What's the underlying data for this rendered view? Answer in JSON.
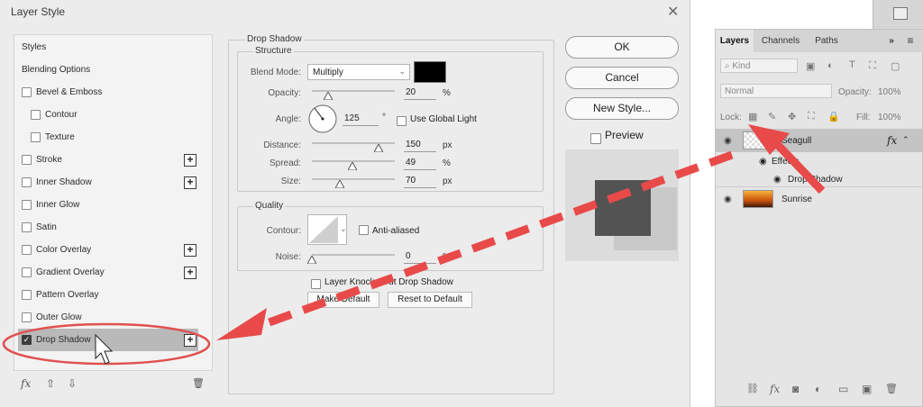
{
  "dialog": {
    "title": "Layer Style",
    "close_glyph": "✕",
    "styles": [
      {
        "label": "Styles",
        "has_checkbox": false,
        "checked": false,
        "has_plus": false
      },
      {
        "label": "Blending Options",
        "has_checkbox": false,
        "checked": false,
        "has_plus": false
      },
      {
        "label": "Bevel & Emboss",
        "has_checkbox": true,
        "checked": false,
        "has_plus": false
      },
      {
        "label": "Contour",
        "has_checkbox": true,
        "checked": false,
        "has_plus": false
      },
      {
        "label": "Texture",
        "has_checkbox": true,
        "checked": false,
        "has_plus": false
      },
      {
        "label": "Stroke",
        "has_checkbox": true,
        "checked": false,
        "has_plus": true
      },
      {
        "label": "Inner Shadow",
        "has_checkbox": true,
        "checked": false,
        "has_plus": true
      },
      {
        "label": "Inner Glow",
        "has_checkbox": true,
        "checked": false,
        "has_plus": false
      },
      {
        "label": "Satin",
        "has_checkbox": true,
        "checked": false,
        "has_plus": false
      },
      {
        "label": "Color Overlay",
        "has_checkbox": true,
        "checked": false,
        "has_plus": true
      },
      {
        "label": "Gradient Overlay",
        "has_checkbox": true,
        "checked": false,
        "has_plus": true
      },
      {
        "label": "Pattern Overlay",
        "has_checkbox": true,
        "checked": false,
        "has_plus": false
      },
      {
        "label": "Outer Glow",
        "has_checkbox": true,
        "checked": false,
        "has_plus": false
      },
      {
        "label": "Drop Shadow",
        "has_checkbox": true,
        "checked": true,
        "has_plus": true
      }
    ],
    "plus_glyph": "+",
    "footer": {
      "fx": "fx",
      "up": "⇧",
      "down": "⇩",
      "trash": "🗑"
    },
    "drop_shadow": {
      "section_title": "Drop Shadow",
      "structure_title": "Structure",
      "blend_mode_label": "Blend Mode:",
      "blend_mode_value": "Multiply",
      "shadow_color": "#000000",
      "opacity_label": "Opacity:",
      "opacity_value": "20",
      "opacity_unit": "%",
      "opacity_level": 0.2,
      "angle_label": "Angle:",
      "angle_value": "125",
      "angle_unit": "°",
      "use_global_light_label": "Use Global Light",
      "use_global_light_checked": true,
      "distance_label": "Distance:",
      "distance_value": "150",
      "distance_unit": "px",
      "spread_label": "Spread:",
      "spread_value": "49",
      "spread_unit": "%",
      "size_label": "Size:",
      "size_value": "70",
      "size_unit": "px",
      "quality_title": "Quality",
      "contour_label": "Contour:",
      "anti_aliased_label": "Anti-aliased",
      "noise_label": "Noise:",
      "noise_value": "0",
      "noise_unit": "%",
      "knockout_label": "Layer Knocks Out Drop Shadow",
      "make_default_label": "Make Default",
      "reset_default_label": "Reset to Default"
    },
    "buttons": {
      "ok": "OK",
      "cancel": "Cancel",
      "new_style": "New Style..."
    },
    "preview_label": "Preview",
    "preview_checked": true
  },
  "layers_panel": {
    "tabs": [
      "Layers",
      "Channels",
      "Paths"
    ],
    "menu_glyph": "≡",
    "collapse_glyph": "»",
    "kind_label": "Kind",
    "blend_mode": "Normal",
    "opacity_label": "Opacity:",
    "opacity_value": "100%",
    "lock_label": "Lock:",
    "fill_label": "Fill:",
    "fill_value": "100%",
    "layers": [
      {
        "name": "Seagull",
        "fx": "fx",
        "selected": true
      },
      {
        "name": "Effects",
        "sub": true
      },
      {
        "name": "Drop Shadow",
        "sub": true
      },
      {
        "name": "Sunrise",
        "selected": false
      }
    ],
    "bottom_icons": [
      "link-icon",
      "fx-icon",
      "mask-icon",
      "adjustment-icon",
      "folder-icon",
      "new-layer-icon",
      "trash-icon"
    ],
    "fx_glyph": "fx"
  },
  "annotation": {
    "arrow_color": "#e84a4a",
    "ellipse_color": "#e05050"
  }
}
